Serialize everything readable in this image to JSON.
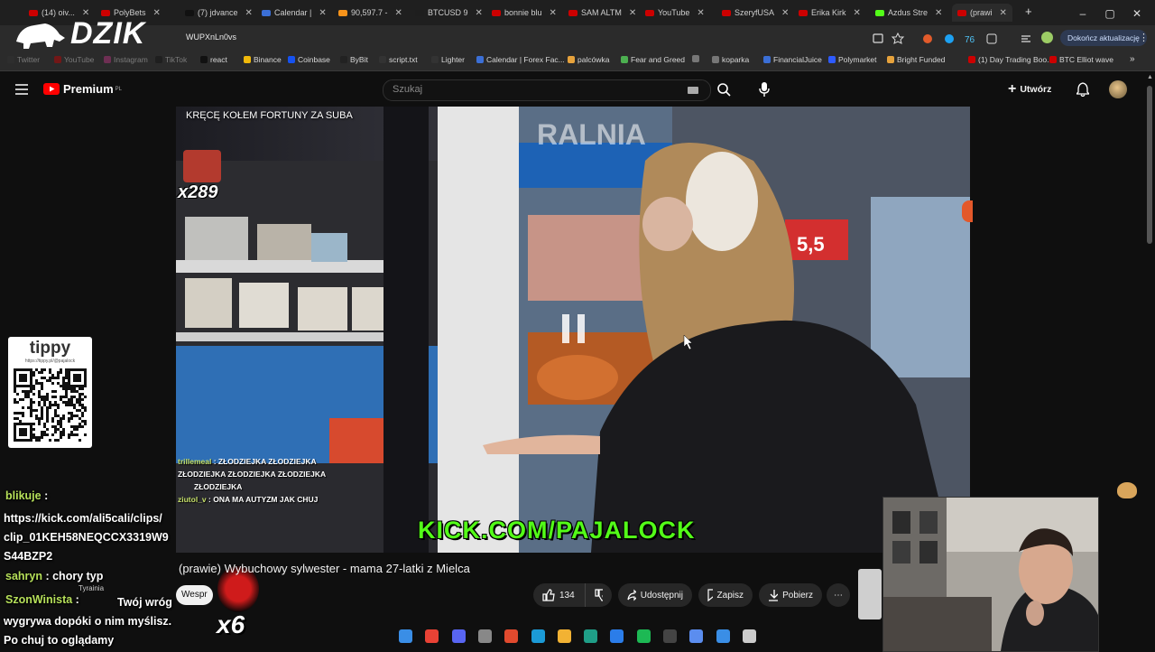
{
  "browser": {
    "tabs": [
      {
        "label": "(14) oiv...",
        "color": "#cc0000"
      },
      {
        "label": "PolyBets",
        "color": "#cc0000"
      },
      {
        "label": "(7) jdvance",
        "color": "#111111"
      },
      {
        "label": "Calendar |",
        "color": "#3b6fd6"
      },
      {
        "label": "90,597.7 -",
        "color": "#f7931a"
      },
      {
        "label": "BTCUSD 9",
        "color": "#1e1e1e"
      },
      {
        "label": "bonnie blu",
        "color": "#cc0000"
      },
      {
        "label": "SAM ALTM",
        "color": "#cc0000"
      },
      {
        "label": "YouTube",
        "color": "#cc0000"
      },
      {
        "label": "SzeryfUSA",
        "color": "#cc0000"
      },
      {
        "label": "Erika Kirk",
        "color": "#cc0000"
      },
      {
        "label": "Azdus Stre",
        "color": "#53fc18"
      },
      {
        "label": "(prawi",
        "color": "#cc0000"
      }
    ],
    "new_tab": "+",
    "url": "WUPXnLn0vs",
    "update_button": "Dokończ aktualizację",
    "bookmarks": [
      {
        "label": "Twitter",
        "color": "#333"
      },
      {
        "label": "YouTube",
        "color": "#cc0000"
      },
      {
        "label": "Instagram",
        "color": "#c13584"
      },
      {
        "label": "TikTok",
        "color": "#111"
      },
      {
        "label": "react",
        "color": "#111"
      },
      {
        "label": "Binance",
        "color": "#f0b90b"
      },
      {
        "label": "Coinbase",
        "color": "#1652f0"
      },
      {
        "label": "ByBit",
        "color": "#222"
      },
      {
        "label": "script.txt",
        "color": "#333"
      },
      {
        "label": "Lighter",
        "color": "#333"
      },
      {
        "label": "Calendar | Forex Fac...",
        "color": "#3b6fd6"
      },
      {
        "label": "palcówka",
        "color": "#e6a23c"
      },
      {
        "label": "Fear and Greed",
        "color": "#4caf50"
      },
      {
        "label": "",
        "color": "#777"
      },
      {
        "label": "koparka",
        "color": "#777"
      },
      {
        "label": "FinancialJuice",
        "color": "#3b6fd6"
      },
      {
        "label": "Polymarket",
        "color": "#2e5bff"
      },
      {
        "label": "Bright Funded",
        "color": "#e6a23c"
      },
      {
        "label": "(1) Day Trading Boo...",
        "color": "#cc0000"
      },
      {
        "label": "BTC Elliot wave",
        "color": "#cc0000"
      }
    ]
  },
  "logo": {
    "text": "DZIK"
  },
  "youtube": {
    "brand": "Premium",
    "brand_sup": "PL",
    "search_placeholder": "Szukaj",
    "create_label": "Utwórz"
  },
  "video": {
    "top_text": "KRĘCĘ KOŁEM FORTUNY ZA SUBA",
    "multiplier": "x289",
    "sign_text": "RALNIA",
    "price_tag": "5,5",
    "cta": "KICK.COM/PAJALOCK",
    "ingame_chat": [
      {
        "user": "trillemeal",
        "text": "ZŁODZIEJKA   ZŁODZIEJKA"
      },
      {
        "user": "",
        "text": "ZŁODZIEJKA   ZŁODZIEJKA   ZŁODZIEJKA"
      },
      {
        "user": "",
        "text": "ZŁODZIEJKA"
      },
      {
        "user": "ziutol_v",
        "text": "ONA MA AUTYZM JAK CHUJ"
      }
    ]
  },
  "tippy": {
    "brand": "tippy",
    "url": "https://tippy.pl/@pajalock"
  },
  "stream_chat": {
    "messages": [
      {
        "user": "blikuje",
        "text": "https://kick.com/ali5cali/clips/ clip_01KEH58NEQCCX3319W9 S44BZP2"
      },
      {
        "user": "sahryn",
        "text": "chory typ"
      },
      {
        "user": "SzonWinista",
        "text": "Twój wróg wygrywa dopóki o nim myślisz. Po chuj to oglądamy"
      }
    ],
    "gift_multiplier": "x6",
    "tag": "Tyrainia"
  },
  "below_video": {
    "title": "(prawie) Wybuchowy sylwester - mama 27-latki z Mielca",
    "support_label": "Wespr",
    "likes": "134",
    "share": "Udostępnij",
    "save": "Zapisz",
    "download": "Pobierz",
    "more": "⋯"
  },
  "colors": {
    "yt_red": "#ff0000",
    "kick_green": "#53fc18",
    "chat_user": "#b6e05a"
  }
}
